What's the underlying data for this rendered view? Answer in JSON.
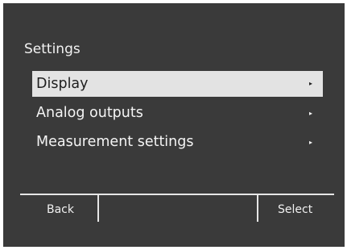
{
  "header": {
    "title": "Settings"
  },
  "menu": {
    "items": [
      {
        "label": "Display",
        "arrow": "▸",
        "selected": true
      },
      {
        "label": "Analog outputs",
        "arrow": "▸",
        "selected": false
      },
      {
        "label": "Measurement settings",
        "arrow": "▸",
        "selected": false
      }
    ]
  },
  "softkeys": {
    "left_label": "Back",
    "center_label": "",
    "right_label": "Select"
  },
  "colors": {
    "background": "#3a3a3a",
    "selection": "#e3e3e3",
    "text": "#f0f0f0",
    "selected_text": "#1f1f1f"
  },
  "icons": {
    "arrow": "chevron-right-icon"
  }
}
